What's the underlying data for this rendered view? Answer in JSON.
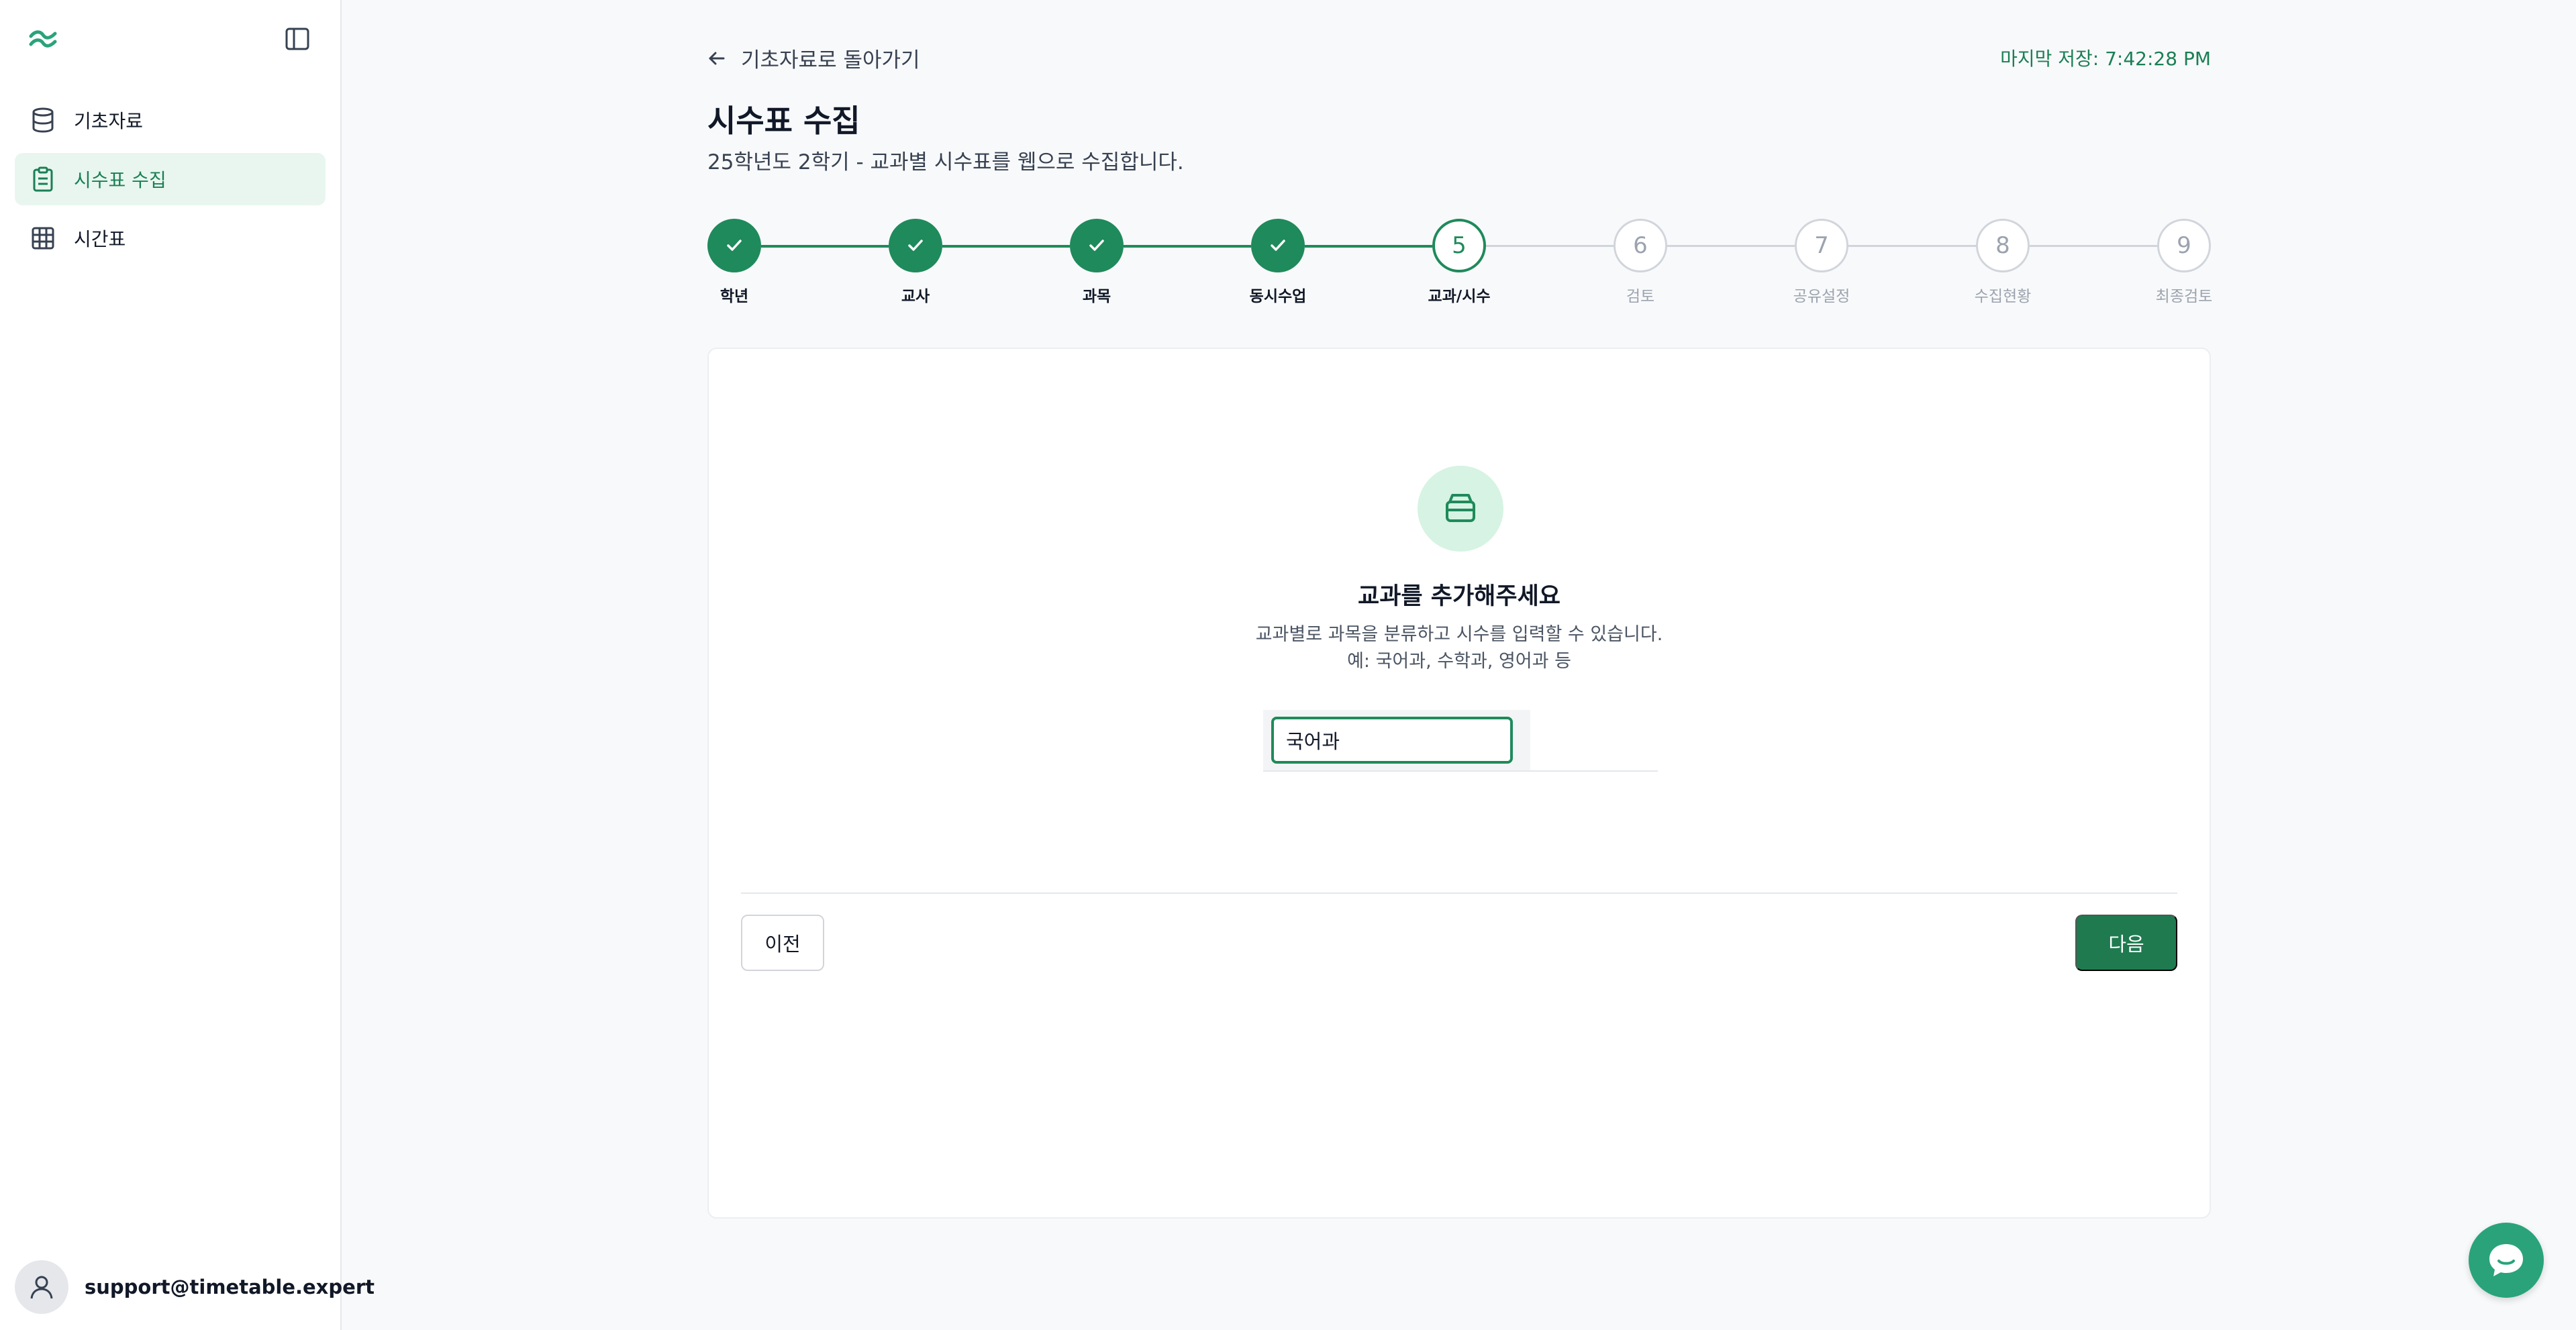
{
  "sidebar": {
    "items": [
      {
        "label": "기초자료",
        "icon": "database-icon"
      },
      {
        "label": "시수표 수집",
        "icon": "clipboard-icon",
        "active": true
      },
      {
        "label": "시간표",
        "icon": "grid-icon"
      }
    ],
    "user_email": "support@timetable.expert"
  },
  "header": {
    "back_label": "기초자료로 돌아가기",
    "saved_text": "마지막 저장: 7:42:28 PM",
    "title": "시수표 수집",
    "subtitle": "25학년도 2학기 - 교과별 시수표를 웹으로 수집합니다."
  },
  "stepper": {
    "current": 5,
    "steps": [
      {
        "number": "1",
        "label": "학년",
        "status": "done"
      },
      {
        "number": "2",
        "label": "교사",
        "status": "done"
      },
      {
        "number": "3",
        "label": "과목",
        "status": "done"
      },
      {
        "number": "4",
        "label": "동시수업",
        "status": "done"
      },
      {
        "number": "5",
        "label": "교과/시수",
        "status": "current"
      },
      {
        "number": "6",
        "label": "검토",
        "status": "todo"
      },
      {
        "number": "7",
        "label": "공유설정",
        "status": "todo"
      },
      {
        "number": "8",
        "label": "수집현황",
        "status": "todo"
      },
      {
        "number": "9",
        "label": "최종검토",
        "status": "todo"
      }
    ]
  },
  "empty_state": {
    "icon": "box-icon",
    "title": "교과를 추가해주세요",
    "desc_line1": "교과별로 과목을 분류하고 시수를 입력할 수 있습니다.",
    "desc_line2": "예: 국어과, 수학과, 영어과 등"
  },
  "input": {
    "value": "국어과"
  },
  "buttons": {
    "prev": "이전",
    "next": "다음"
  },
  "colors": {
    "accent": "#1f8a5b",
    "accent_dark": "#1f7a50",
    "accent_light": "#d6f3e3",
    "chat": "#2aa37a"
  }
}
